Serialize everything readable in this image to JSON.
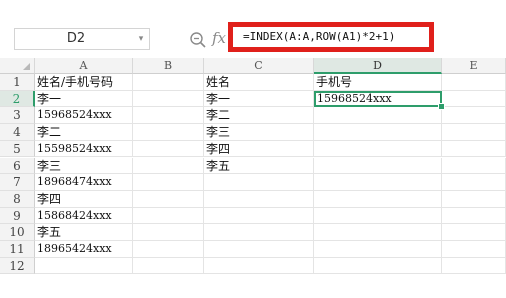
{
  "formula_bar": {
    "name_box": "D2",
    "formula": "=INDEX(A:A,ROW(A1)*2+1)"
  },
  "icons": {
    "zoom": "zoom-icon",
    "fx": "fx"
  },
  "columns": [
    "A",
    "B",
    "C",
    "D",
    "E"
  ],
  "active_column": "D",
  "rows": [
    1,
    2,
    3,
    4,
    5,
    6,
    7,
    8,
    9,
    10,
    11,
    12
  ],
  "active_row": 2,
  "cells": {
    "A1": "姓名/手机号码",
    "A2": "李一",
    "A3": "15968524xxx",
    "A4": "李二",
    "A5": "15598524xxx",
    "A6": "李三",
    "A7": "18968474xxx",
    "A8": "李四",
    "A9": "15868424xxx",
    "A10": "李五",
    "A11": "18965424xxx",
    "C1": "姓名",
    "C2": "李一",
    "C3": "李二",
    "C4": "李三",
    "C5": "李四",
    "C6": "李五",
    "D1": "手机号",
    "D2": "15968524xxx"
  },
  "colors": {
    "selection": "#2e9d6b",
    "highlight_box": "#e0201b"
  }
}
